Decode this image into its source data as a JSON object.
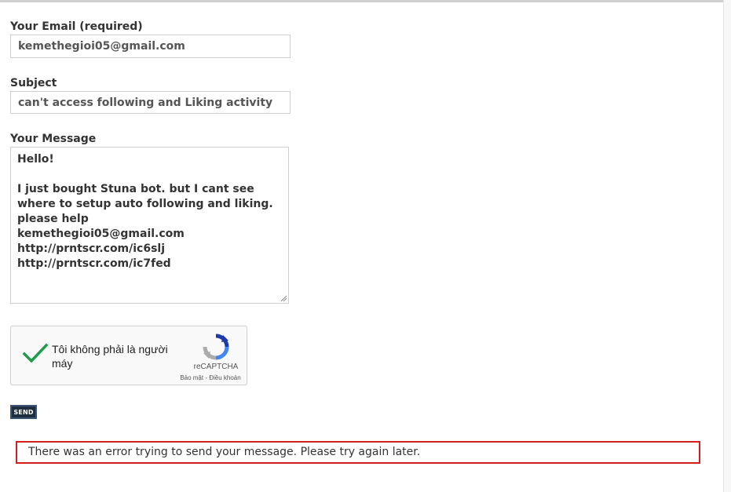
{
  "form": {
    "email": {
      "label": "Your Email (required)",
      "value": "kemethegioi05@gmail.com"
    },
    "subject": {
      "label": "Subject",
      "value": "can't access following and Liking activity"
    },
    "message": {
      "label": "Your Message",
      "value": "Hello!\n\nI just bought Stuna bot. but I cant see where to setup auto following and liking. please help\nkemethegioi05@gmail.com\nhttp://prntscr.com/ic6slj\nhttp://prntscr.com/ic7fed"
    },
    "send_label": "SEND"
  },
  "recaptcha": {
    "checkbox_label": "Tôi không phải là người máy",
    "brand": "reCAPTCHA",
    "terms": "Bảo mật - Điều khoản",
    "check_color": "#1e9c4a",
    "icons": [
      "checkmark-icon",
      "recaptcha-logo-icon"
    ]
  },
  "status": {
    "error_message": "There was an error trying to send your message. Please try again later.",
    "error_color": "#d11f1f"
  }
}
